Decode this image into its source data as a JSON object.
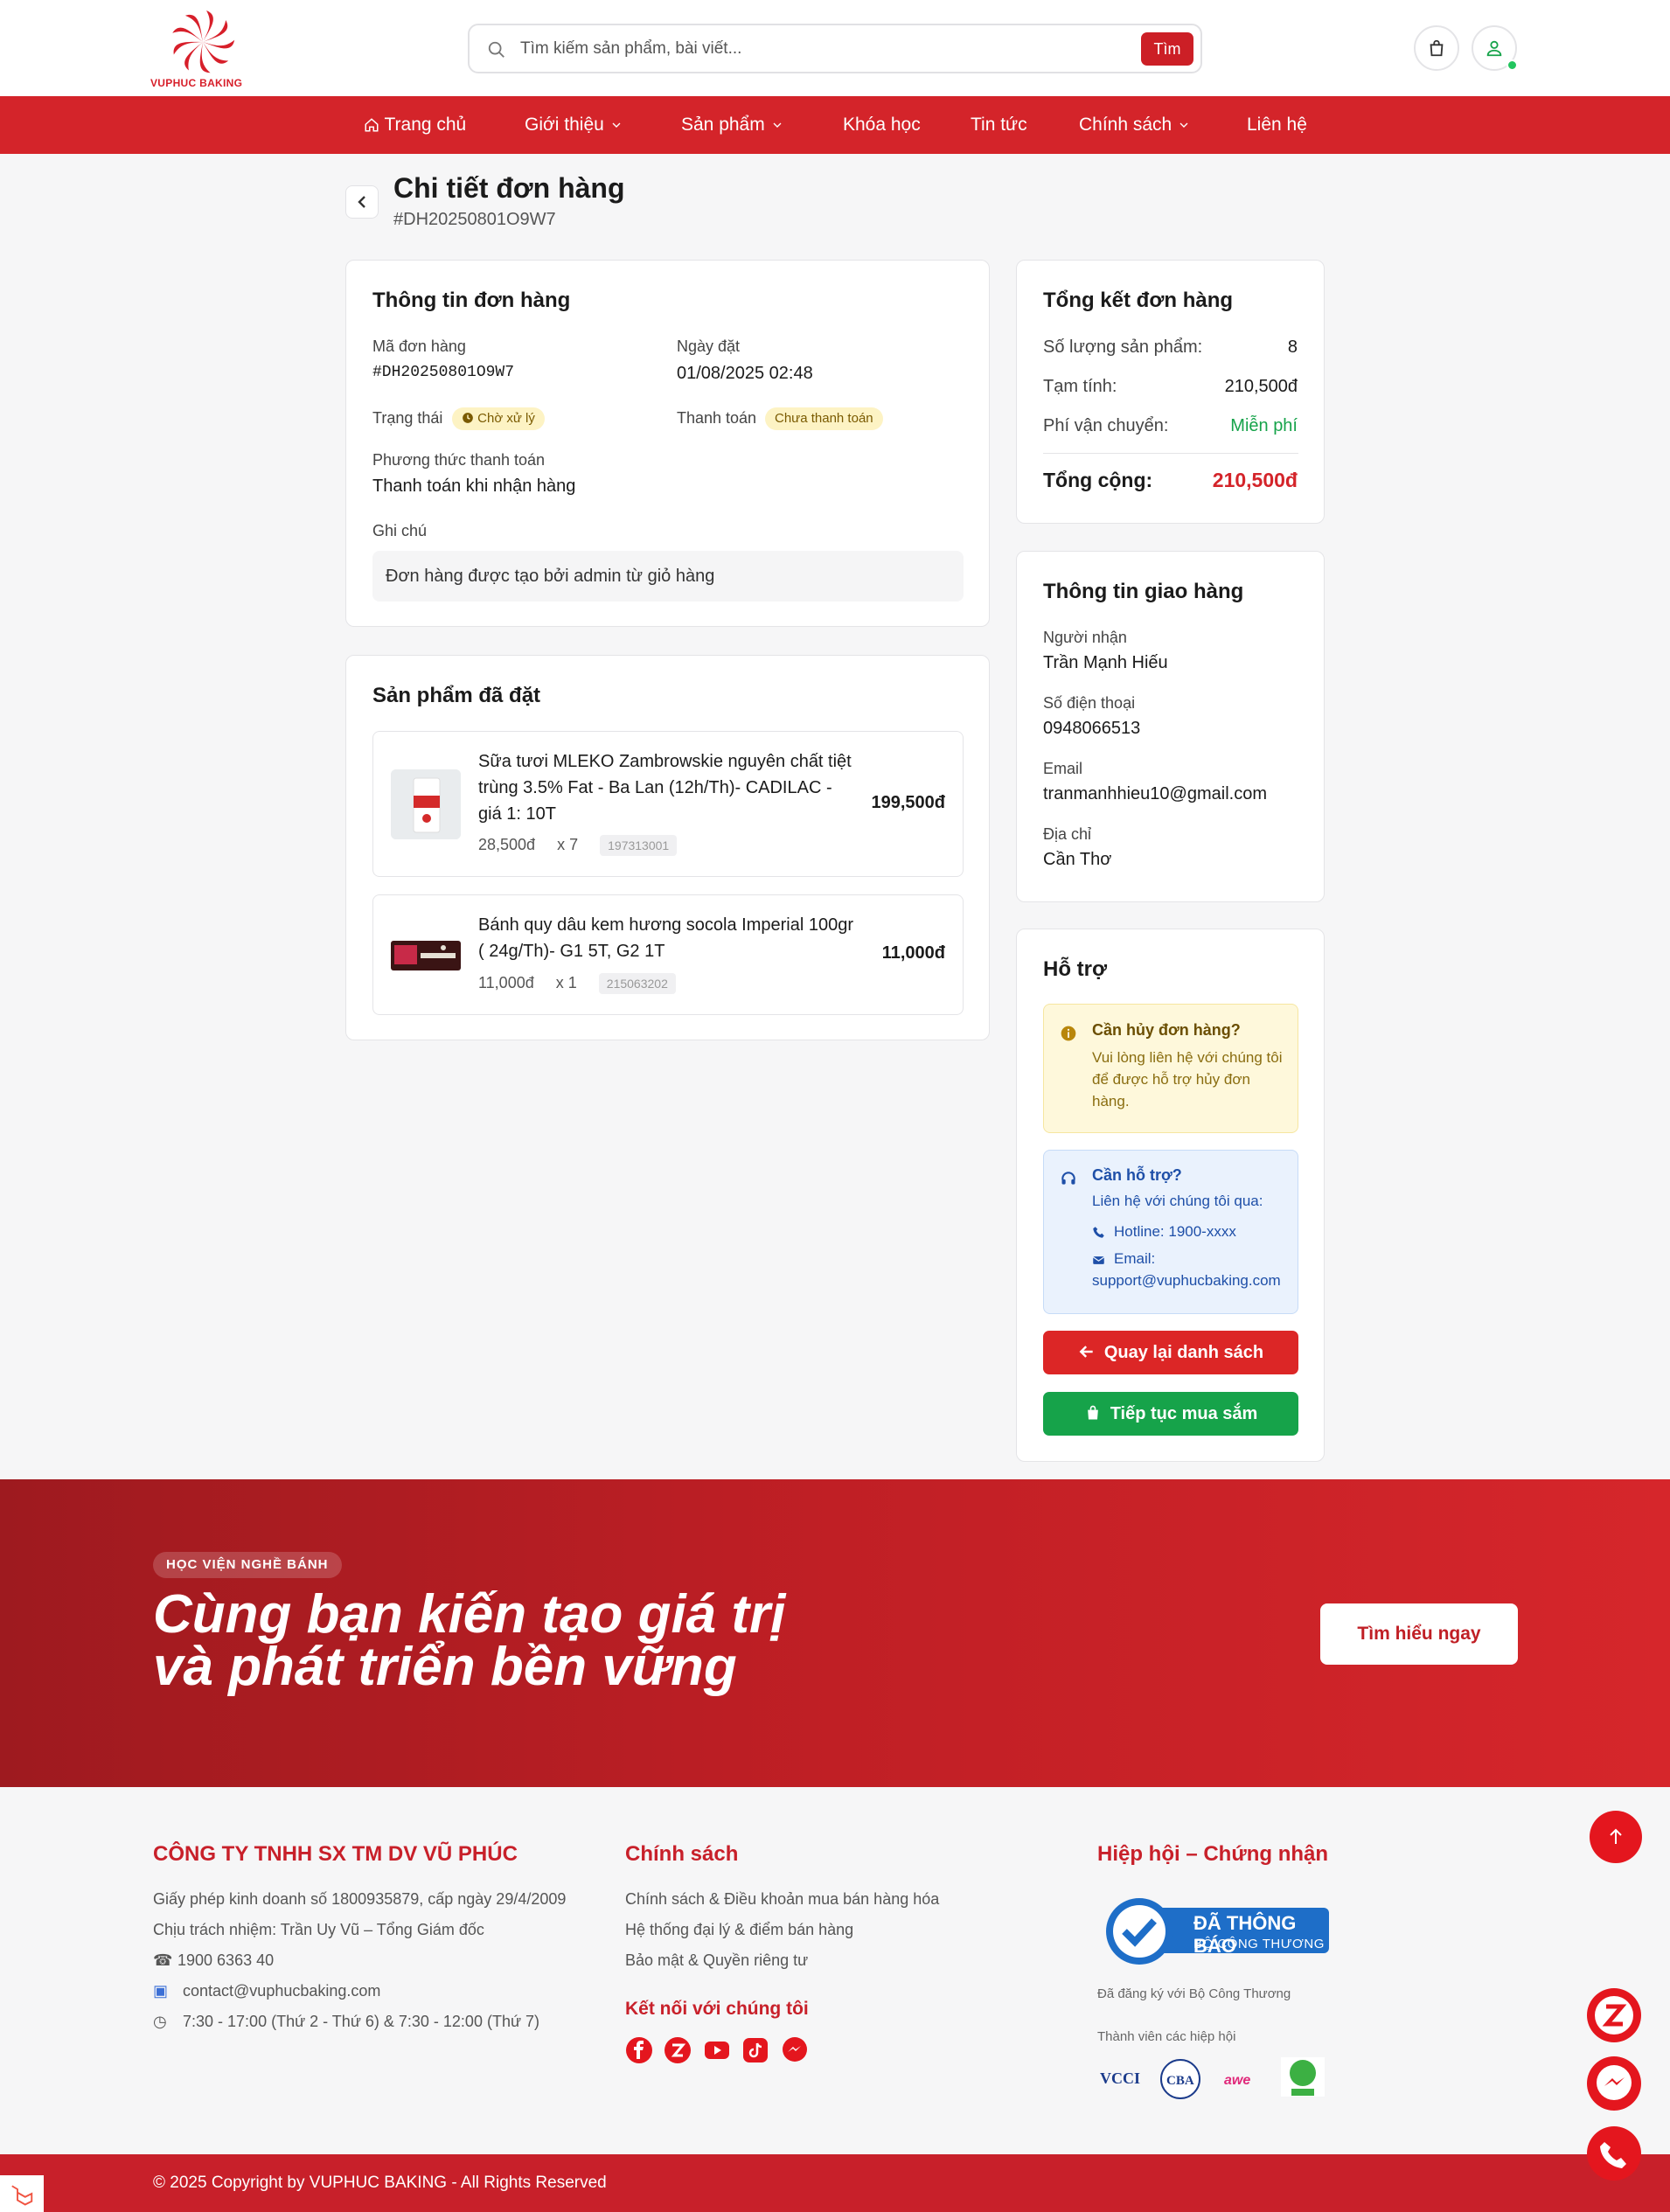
{
  "brand": {
    "name": "VUPHUC BAKING",
    "color": "#d4242a"
  },
  "search": {
    "placeholder": "Tìm kiếm sản phẩm, bài viết...",
    "button": "Tìm"
  },
  "nav": [
    {
      "label": "Trang chủ",
      "icon": "home-icon"
    },
    {
      "label": "Giới thiệu",
      "dropdown": true
    },
    {
      "label": "Sản phẩm",
      "dropdown": true
    },
    {
      "label": "Khóa học"
    },
    {
      "label": "Tin tức"
    },
    {
      "label": "Chính sách",
      "dropdown": true
    },
    {
      "label": "Liên hệ"
    }
  ],
  "page": {
    "title": "Chi tiết đơn hàng",
    "order_code": "#DH20250801O9W7"
  },
  "order_info": {
    "title": "Thông tin đơn hàng",
    "code_label": "Mã đơn hàng",
    "code": "#DH20250801O9W7",
    "date_label": "Ngày đặt",
    "date": "01/08/2025 02:48",
    "status_label": "Trạng thái",
    "status": "Chờ xử lý",
    "payment_label": "Thanh toán",
    "payment_status": "Chưa thanh toán",
    "method_label": "Phương thức thanh toán",
    "method": "Thanh toán khi nhận hàng",
    "note_label": "Ghi chú",
    "note": "Đơn hàng được tạo bởi admin từ giỏ hàng"
  },
  "products": {
    "title": "Sản phẩm đã đặt",
    "items": [
      {
        "name": "Sữa tươi MLEKO Zambrowskie nguyên chất tiệt trùng 3.5% Fat - Ba Lan (12h/Th)- CADILAC - giá 1: 10T",
        "price": "28,500đ",
        "qty": "x 7",
        "sku": "197313001",
        "total": "199,500đ"
      },
      {
        "name": "Bánh quy dâu kem hương socola Imperial 100gr ( 24g/Th)- G1 5T, G2 1T",
        "price": "11,000đ",
        "qty": "x 1",
        "sku": "215063202",
        "total": "11,000đ"
      }
    ]
  },
  "summary": {
    "title": "Tổng kết đơn hàng",
    "qty_label": "Số lượng sản phẩm:",
    "qty": "8",
    "subtotal_label": "Tạm tính:",
    "subtotal": "210,500đ",
    "ship_label": "Phí vận chuyển:",
    "ship": "Miễn phí",
    "total_label": "Tổng cộng:",
    "total": "210,500đ"
  },
  "shipping": {
    "title": "Thông tin giao hàng",
    "receiver_label": "Người nhận",
    "receiver": "Trần Mạnh Hiếu",
    "phone_label": "Số điện thoại",
    "phone": "0948066513",
    "email_label": "Email",
    "email": "tranmanhhieu10@gmail.com",
    "address_label": "Địa chỉ",
    "address": "Cần Thơ"
  },
  "support": {
    "title": "Hỗ trợ",
    "cancel_title": "Cần hủy đơn hàng?",
    "cancel_text": "Vui lòng liên hệ với chúng tôi để được hỗ trợ hủy đơn hàng.",
    "help_title": "Cần hỗ trợ?",
    "help_text": "Liên hệ với chúng tôi qua:",
    "hotline": "Hotline: 1900-xxxx",
    "email_label": "Email:",
    "email": "support@vuphucbaking.com",
    "back_button": "Quay lại danh sách",
    "shop_button": "Tiếp tục mua sắm"
  },
  "banner": {
    "pill": "HỌC VIỆN NGHỀ BÁNH",
    "line1": "Cùng bạn kiến tạo giá trị",
    "line2": "và phát triển bền vững",
    "button": "Tìm hiểu ngay"
  },
  "footer": {
    "company": "CÔNG TY TNHH SX TM DV VŨ PHÚC",
    "license": "Giấy phép kinh doanh số 1800935879, cấp ngày 29/4/2009",
    "responsible": "Chịu trách nhiệm: Trần Uy Vũ – Tổng Giám đốc",
    "phone": "1900 6363 40",
    "email": "contact@vuphucbaking.com",
    "hours": "7:30 - 17:00 (Thứ 2 - Thứ 6) & 7:30 - 12:00 (Thứ 7)",
    "policy_title": "Chính sách",
    "policies": [
      "Chính sách & Điều khoản mua bán hàng hóa",
      "Hệ thống đại lý & điểm bán hàng",
      "Bảo mật & Quyền riêng tư"
    ],
    "connect_title": "Kết nối với chúng tôi",
    "assoc_title": "Hiệp hội – Chứng nhận",
    "cert_line1": "ĐÃ THÔNG BÁO",
    "cert_line2": "BỘ CÔNG THƯƠNG",
    "registered": "Đã đăng ký với Bộ Công Thương",
    "member": "Thành viên các hiệp hội",
    "copyright": "© 2025 Copyright by VUPHUC BAKING - All Rights Reserved"
  },
  "colors": {
    "primary": "#d4242a",
    "green": "#16a34a",
    "badge_yellow": "#fdf3c4"
  }
}
